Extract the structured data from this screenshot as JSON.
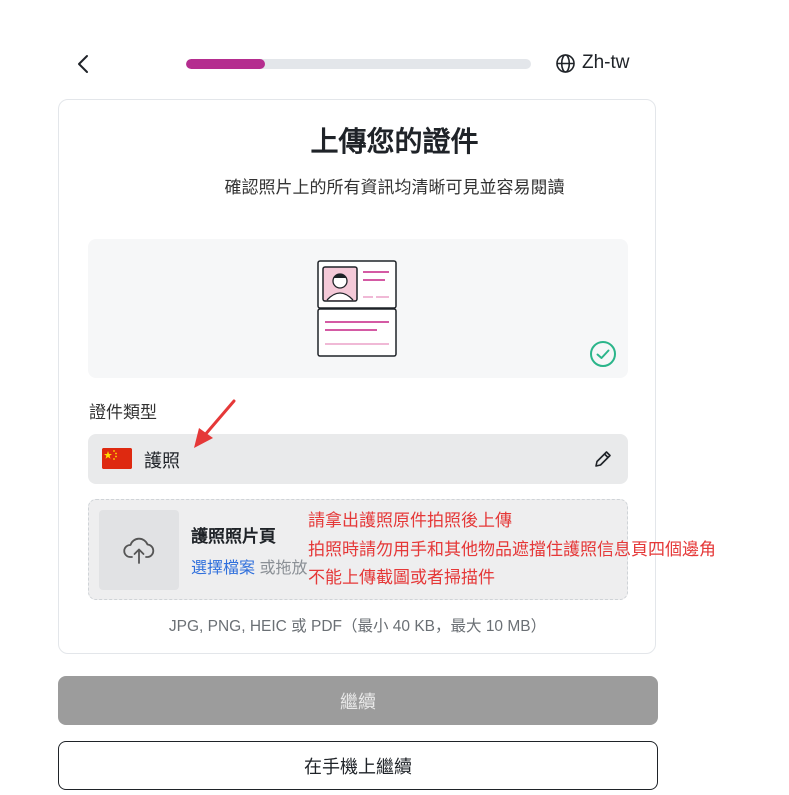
{
  "header": {
    "language_label": "Zh-tw",
    "progress_fraction": 0.23,
    "progress_color": "#b52d8f"
  },
  "main": {
    "title": "上傳您的證件",
    "subtitle": "確認照片上的所有資訊均清晰可見並容易閱讀",
    "doc_type_label": "證件類型",
    "doc_type_value": "護照",
    "upload_title": "護照照片頁",
    "upload_choose_link": "選擇檔案",
    "upload_drag_text": "或拖放",
    "formats_note": "JPG, PNG, HEIC 或 PDF（最小 40 KB，最大 10 MB）"
  },
  "annotations": [
    "請拿出護照原件拍照後上傳",
    "拍照時請勿用手和其他物品遮擋住護照信息頁四個邊角",
    "不能上傳截圖或者掃描件"
  ],
  "buttons": {
    "continue_label": "繼續",
    "mobile_label": "在手機上繼續"
  },
  "icons": {
    "back": "chevron-left-icon",
    "language": "globe-icon",
    "check": "check-circle-icon",
    "edit": "pencil-icon",
    "upload": "cloud-upload-icon",
    "flag": "china-flag-icon"
  },
  "colors": {
    "annotation": "#e53838",
    "link": "#2f6fdc",
    "success": "#2bb58a"
  }
}
